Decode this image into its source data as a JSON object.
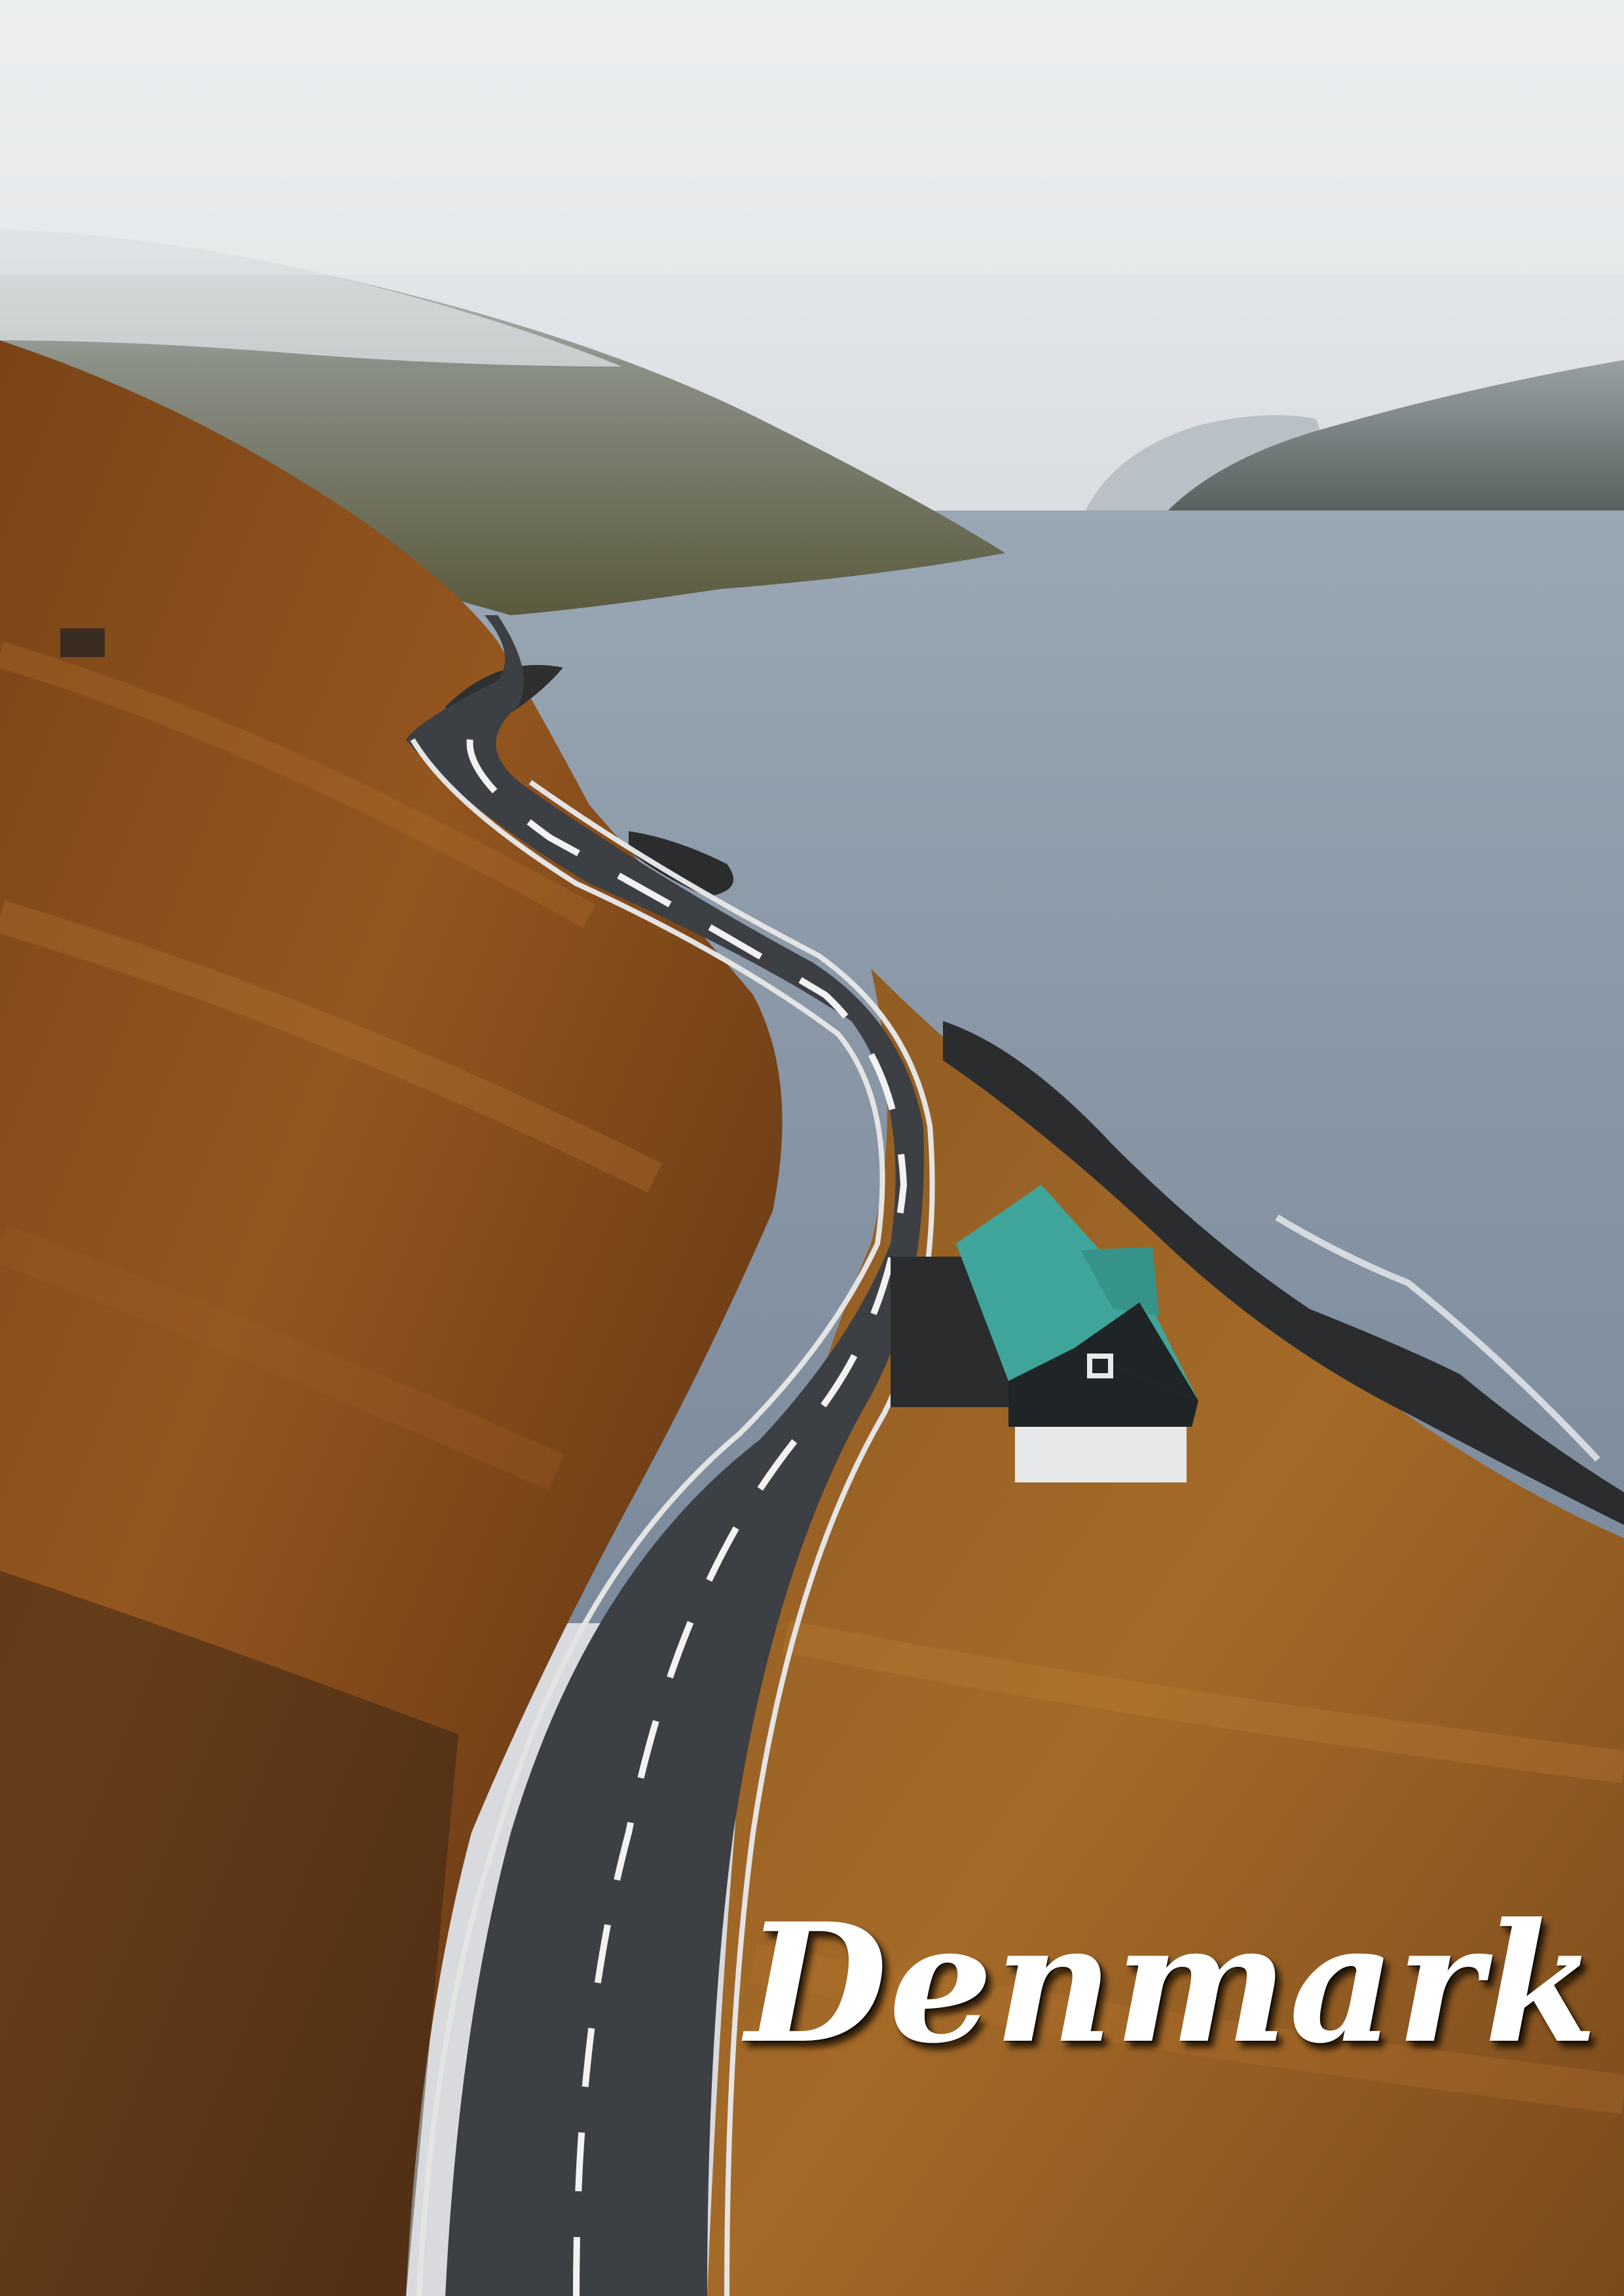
{
  "poster": {
    "title": "Denmark"
  },
  "scene": {
    "elements": [
      "sky",
      "distant-mountains",
      "fjord-water",
      "left-hillside",
      "winding-road",
      "house-with-green-roof",
      "right-hillside",
      "rocky-shoreline"
    ]
  },
  "colors": {
    "sky": "#e6e8ea",
    "water": "#8796a6",
    "hillside": "#8a4f1c",
    "road": "#3c3f44",
    "roof": "#3fa59a",
    "house_wall": "#1f2426"
  }
}
